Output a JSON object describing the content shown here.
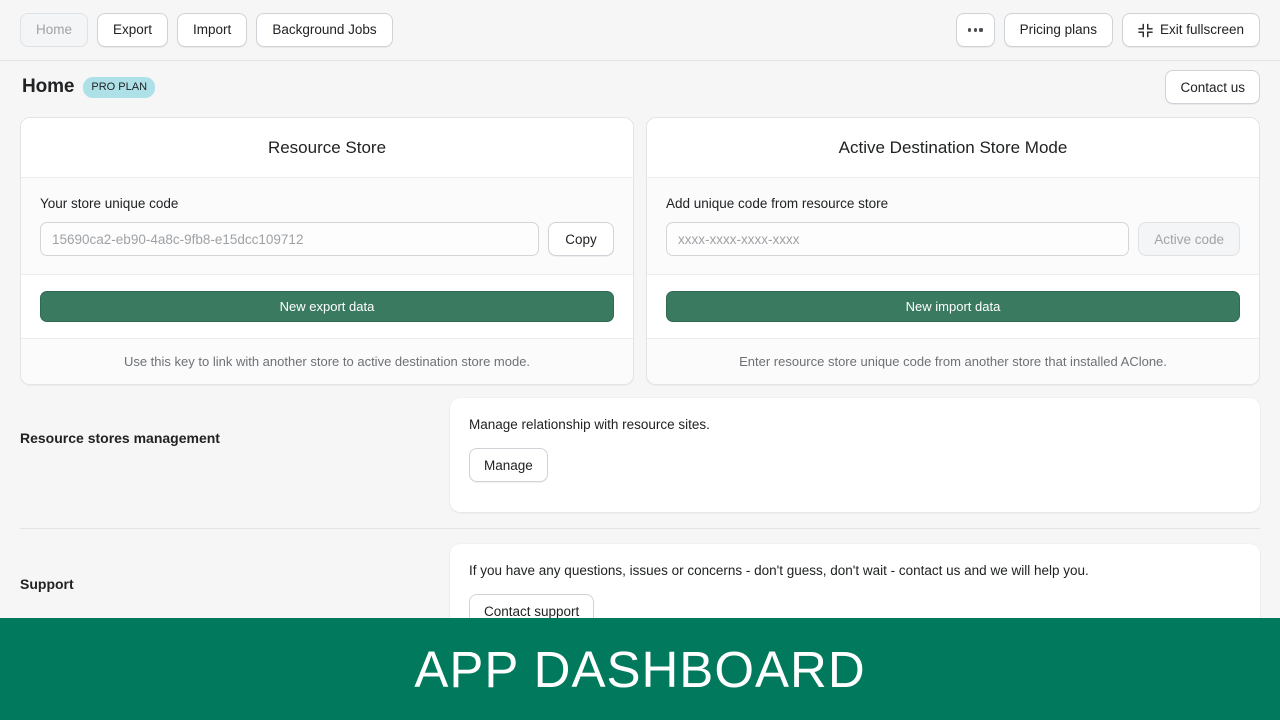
{
  "toolbar": {
    "nav": [
      {
        "label": "Home",
        "state": "current"
      },
      {
        "label": "Export",
        "state": "default"
      },
      {
        "label": "Import",
        "state": "default"
      },
      {
        "label": "Background Jobs",
        "state": "default"
      }
    ],
    "more_label": "",
    "more_icon": "ellipsis-icon",
    "pricing_label": "Pricing plans",
    "fullscreen_label": "Exit fullscreen",
    "fullscreen_icon": "exit-fullscreen-icon"
  },
  "header": {
    "title": "Home",
    "badge": "PRO PLAN",
    "contact_label": "Contact us"
  },
  "cards": {
    "resource_store": {
      "title": "Resource Store",
      "field_label": "Your store unique code",
      "input_value": "15690ca2-eb90-4a8c-9fb8-e15dcc109712",
      "input_placeholder": "15690ca2-eb90-4a8c-9fb8-e15dcc109712",
      "side_button": "Copy",
      "primary_button": "New export data",
      "footer": "Use this key to link with another store to active destination store mode."
    },
    "destination_store": {
      "title": "Active Destination Store Mode",
      "field_label": "Add unique code from resource store",
      "input_value": "",
      "input_placeholder": "xxxx-xxxx-xxxx-xxxx",
      "side_button": "Active code",
      "primary_button": "New import data",
      "footer": "Enter resource store unique code from another store that installed AClone."
    }
  },
  "sections": [
    {
      "title": "Resource stores management",
      "description": "Manage relationship with resource sites.",
      "button": "Manage"
    },
    {
      "title": "Support",
      "description": "If you have any questions, issues or concerns - don't guess, don't wait - contact us and we will help you.",
      "button": "Contact support"
    }
  ],
  "banner": {
    "text": "APP DASHBOARD",
    "color": "#00795c"
  },
  "colors": {
    "primary_green": "#3a7a60",
    "banner_green": "#00795c",
    "badge_blue": "#aee0e8",
    "page_background": "#f6f6f7"
  }
}
